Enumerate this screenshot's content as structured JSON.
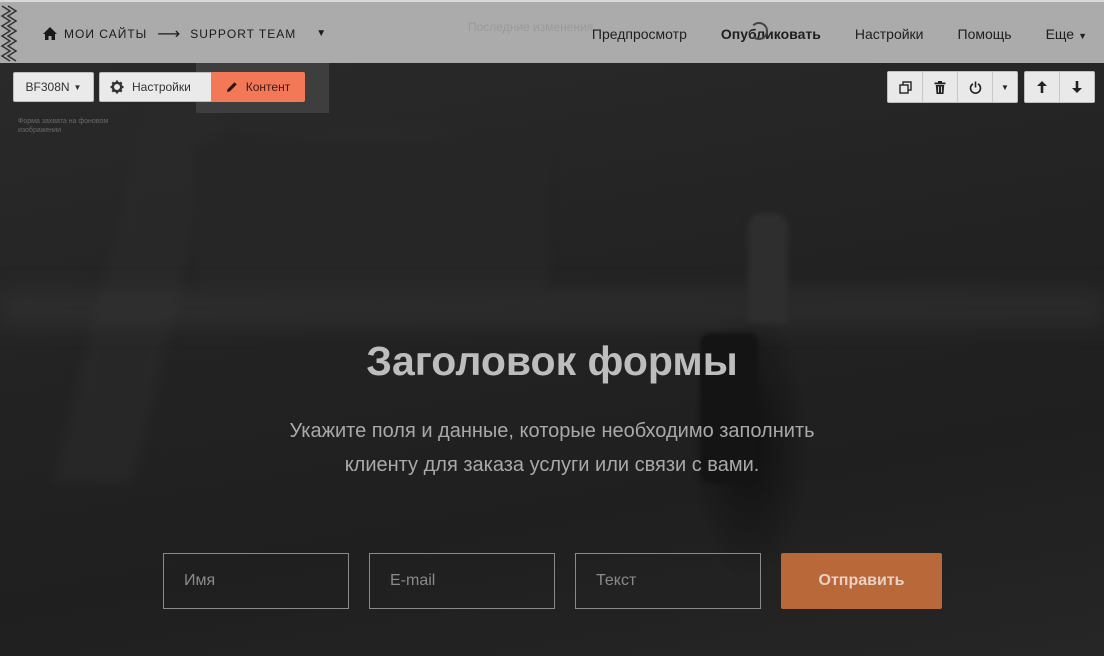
{
  "topbar": {
    "crumb_sites": "МОИ САЙТЫ",
    "crumb_arrow": "⟶",
    "crumb_current": "SUPPORT TEAM",
    "ghost_text": "Последние изменения",
    "nav": {
      "preview": "Предпросмотр",
      "publish": "Опубликовать",
      "settings": "Настройки",
      "help": "Помощь",
      "more": "Еще"
    }
  },
  "editor": {
    "block_id": "BF308N",
    "settings_label": "Настройки",
    "content_label": "Контент",
    "block_caption": "Форма захвата на фоновом изображении",
    "accent_color": "#f37858"
  },
  "form": {
    "title": "Заголовок формы",
    "subtitle": "Укажите поля и данные, которые необходимо заполнить клиенту для заказа услуги или связи с вами.",
    "name_placeholder": "Имя",
    "email_placeholder": "E-mail",
    "text_placeholder": "Текст",
    "submit_label": "Отправить",
    "submit_color": "#b9683a"
  }
}
